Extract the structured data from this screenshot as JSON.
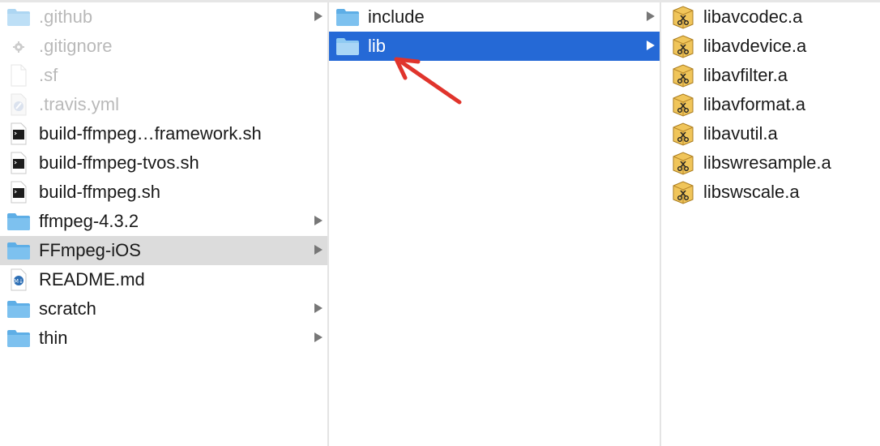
{
  "columns": [
    {
      "items": [
        {
          "label": ".github",
          "icon": "folder-icon",
          "dim": true,
          "chevron": true
        },
        {
          "label": ".gitignore",
          "icon": "gear-file-icon",
          "dim": true,
          "chevron": false
        },
        {
          "label": ".sf",
          "icon": "blank-file-icon",
          "dim": true,
          "chevron": false
        },
        {
          "label": ".travis.yml",
          "icon": "script-file-icon",
          "dim": true,
          "chevron": false
        },
        {
          "label": "build-ffmpeg…framework.sh",
          "icon": "terminal-file-icon",
          "dim": false,
          "chevron": false
        },
        {
          "label": "build-ffmpeg-tvos.sh",
          "icon": "terminal-file-icon",
          "dim": false,
          "chevron": false
        },
        {
          "label": "build-ffmpeg.sh",
          "icon": "terminal-file-icon",
          "dim": false,
          "chevron": false
        },
        {
          "label": "ffmpeg-4.3.2",
          "icon": "folder-icon",
          "dim": false,
          "chevron": true
        },
        {
          "label": "FFmpeg-iOS",
          "icon": "folder-icon",
          "dim": false,
          "chevron": true,
          "selected": "gray"
        },
        {
          "label": "README.md",
          "icon": "markdown-file-icon",
          "dim": false,
          "chevron": false
        },
        {
          "label": "scratch",
          "icon": "folder-icon",
          "dim": false,
          "chevron": true
        },
        {
          "label": "thin",
          "icon": "folder-icon",
          "dim": false,
          "chevron": true
        }
      ]
    },
    {
      "items": [
        {
          "label": "include",
          "icon": "folder-icon",
          "dim": false,
          "chevron": true
        },
        {
          "label": "lib",
          "icon": "folder-icon",
          "dim": false,
          "chevron": true,
          "selected": "blue"
        }
      ]
    },
    {
      "items": [
        {
          "label": "libavcodec.a",
          "icon": "static-library-icon",
          "dim": false,
          "chevron": false
        },
        {
          "label": "libavdevice.a",
          "icon": "static-library-icon",
          "dim": false,
          "chevron": false
        },
        {
          "label": "libavfilter.a",
          "icon": "static-library-icon",
          "dim": false,
          "chevron": false
        },
        {
          "label": "libavformat.a",
          "icon": "static-library-icon",
          "dim": false,
          "chevron": false
        },
        {
          "label": "libavutil.a",
          "icon": "static-library-icon",
          "dim": false,
          "chevron": false
        },
        {
          "label": "libswresample.a",
          "icon": "static-library-icon",
          "dim": false,
          "chevron": false
        },
        {
          "label": "libswscale.a",
          "icon": "static-library-icon",
          "dim": false,
          "chevron": false
        }
      ]
    }
  ],
  "colors": {
    "selection_blue": "#2569d6",
    "selection_gray": "#dcdcdc",
    "annotation_arrow": "#e0342c",
    "folder": "#6cb8ec"
  }
}
